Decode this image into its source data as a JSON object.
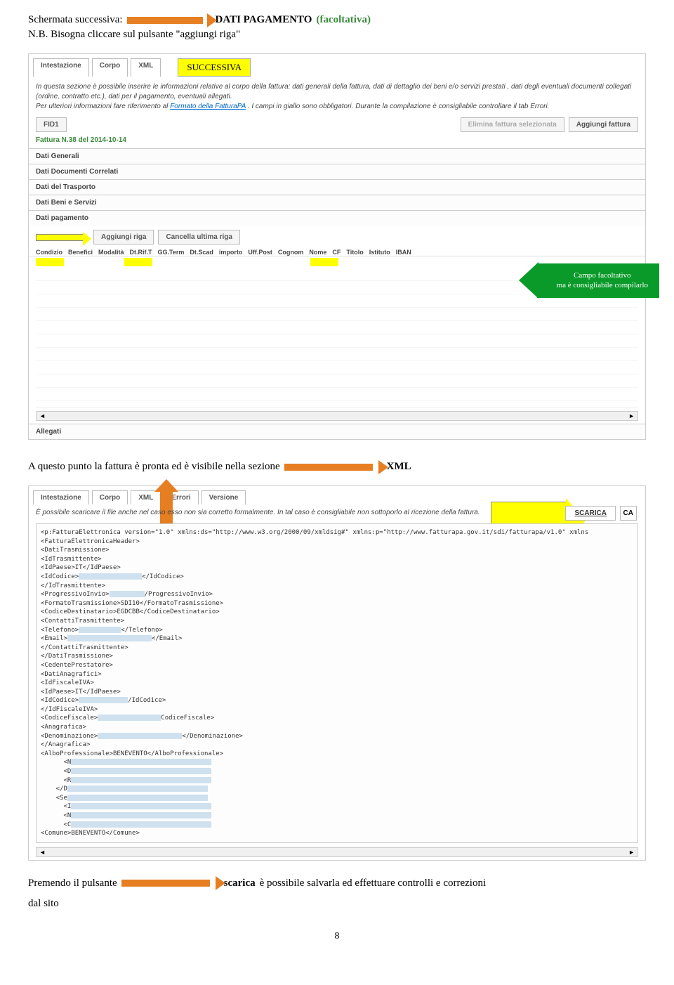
{
  "header": {
    "schermata": "Schermata successiva:",
    "dati_pagamento": "DATI PAGAMENTO",
    "facoltativa": "(facoltativa)",
    "nb": "N.B. Bisogna cliccare sul pulsante \"aggiungi riga\""
  },
  "panel1": {
    "tabs": [
      "Intestazione",
      "Corpo",
      "XML"
    ],
    "callout": "SUCCESSIVA",
    "desc1": "In questa sezione è possibile inserire le informazioni relative al corpo della fattura: dati generali della fattura, dati di dettaglio dei beni e/o servizi prestati , dati degli eventuali documenti collegati (ordine, contratto etc.), dati per il pagamento, eventuali allegati.",
    "desc2_a": "Per ulteriori informazioni fare riferimento al ",
    "desc2_link": "Formato della FatturaPA",
    "desc2_b": ". I campi in giallo sono obbligatori. Durante la compilazione è consigliabile controllare il tab Errori.",
    "fid": "FID1",
    "btn_elimina": "Elimina fattura selezionata",
    "btn_aggiungi_fattura": "Aggiungi fattura",
    "fattura_label": "Fattura N.38 del 2014-10-14",
    "sections": [
      "Dati Generali",
      "Dati Documenti Correlati",
      "Dati del Trasporto",
      "Dati Beni e Servizi",
      "Dati pagamento"
    ],
    "btn_aggiungi_riga": "Aggiungi riga",
    "btn_cancella": "Cancella ultima riga",
    "cols": [
      "Condizio",
      "Benefici",
      "Modalità",
      "Dt.Rif.T",
      "GG.Term",
      "Dt.Scad",
      "importo",
      "Uff.Post",
      "Cognom",
      "Nome",
      "CF",
      "Titolo",
      "Istituto",
      "IBAN"
    ],
    "allegati": "Allegati",
    "green_callout": "Campo facoltativo\nma è consigliabile compilarlo"
  },
  "mid": {
    "text_a": "A questo punto la fattura è pronta ed è visibile nella sezione",
    "text_b": "XML"
  },
  "panel2": {
    "tabs": [
      "Intestazione",
      "Corpo",
      "XML",
      "Errori",
      "Versione"
    ],
    "desc": "È possibile scaricare il file anche nel caso esso non sia corretto formalmente. In tal caso è consigliabile non sottoporlo al ricezione della fattura.",
    "scarica": "SCARICA",
    "ca": "CA",
    "xml": {
      "l1": "<p:FatturaElettronica version=\"1.0\" xmlns:ds=\"http://www.w3.org/2000/09/xmldsig#\" xmlns:p=\"http://www.fatturapa.gov.it/sdi/fatturapa/v1.0\" xmlns",
      "l2": "  <FatturaElettronicaHeader>",
      "l3": "    <DatiTrasmissione>",
      "l4": "      <IdTrasmittente>",
      "l5": "        <IdPaese>IT</IdPaese>",
      "l6_a": "        <IdCodice>",
      "l6_b": "</IdCodice>",
      "l7": "      </IdTrasmittente>",
      "l8_a": "      <ProgressivoInvio>",
      "l8_b": "/ProgressivoInvio>",
      "l9": "      <FormatoTrasmissione>SDI10</FormatoTrasmissione>",
      "l10": "      <CodiceDestinatario>EGDCBB</CodiceDestinatario>",
      "l11": "      <ContattiTrasmittente>",
      "l12_a": "        <Telefono>",
      "l12_b": "</Telefono>",
      "l13_a": "        <Email>",
      "l13_b": "</Email>",
      "l14": "      </ContattiTrasmittente>",
      "l15": "    </DatiTrasmissione>",
      "l16": "    <CedentePrestatore>",
      "l17": "      <DatiAnagrafici>",
      "l18": "        <IdFiscaleIVA>",
      "l19": "          <IdPaese>IT</IdPaese>",
      "l20_a": "          <IdCodice>",
      "l20_b": "/IdCodice>",
      "l21": "        </IdFiscaleIVA>",
      "l22_a": "        <CodiceFiscale>",
      "l22_b": "CodiceFiscale>",
      "l23": "        <Anagrafica>",
      "l24_a": "          <Denominazione>",
      "l24_b": "</Denominazione>",
      "l25": "        </Anagrafica>",
      "l26": "        <AlboProfessionale>BENEVENTO</AlboProfessionale>",
      "l31": "      <Comune>BENEVENTO</Comune>"
    }
  },
  "footer": {
    "text_a": "Premendo il pulsante",
    "text_b_bold": "scarica",
    "text_c": "è possibile salvarla ed effettuare controlli e correzioni",
    "dal_sito": "dal sito",
    "page": "8"
  }
}
